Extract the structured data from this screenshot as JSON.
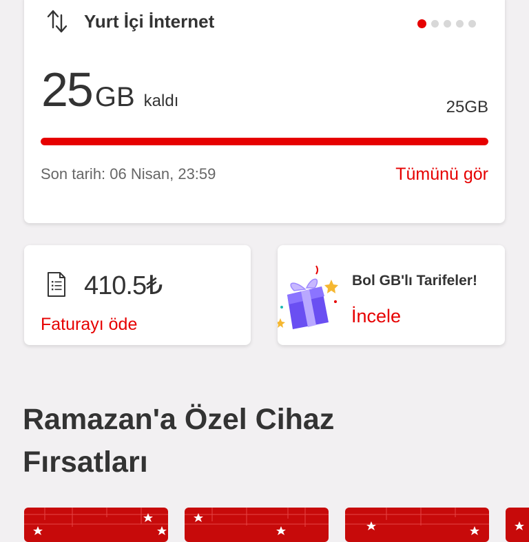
{
  "usage": {
    "title": "Yurt İçi İnternet",
    "remaining_value": "25",
    "remaining_unit": "GB",
    "remaining_suffix": "kaldı",
    "total": "25GB",
    "progress_fraction": 1.0,
    "deadline": "Son tarih: 06 Nisan, 23:59",
    "see_all_label": "Tümünü gör",
    "page_dots": 5,
    "active_dot": 0,
    "icon": "data-transfer-icon"
  },
  "bill": {
    "amount": "410.5₺",
    "pay_label": "Faturayı öde",
    "icon": "invoice-icon"
  },
  "promo": {
    "title": "Bol GB'lı Tarifeler!",
    "link_label": "İncele",
    "icon": "gift-box-icon"
  },
  "section": {
    "title": "Ramazan'a Özel Cihaz Fırsatları"
  },
  "colors": {
    "accent": "#e60000",
    "background": "#f2f0f2",
    "card": "#ffffff",
    "text": "#333333",
    "muted": "#666666"
  }
}
